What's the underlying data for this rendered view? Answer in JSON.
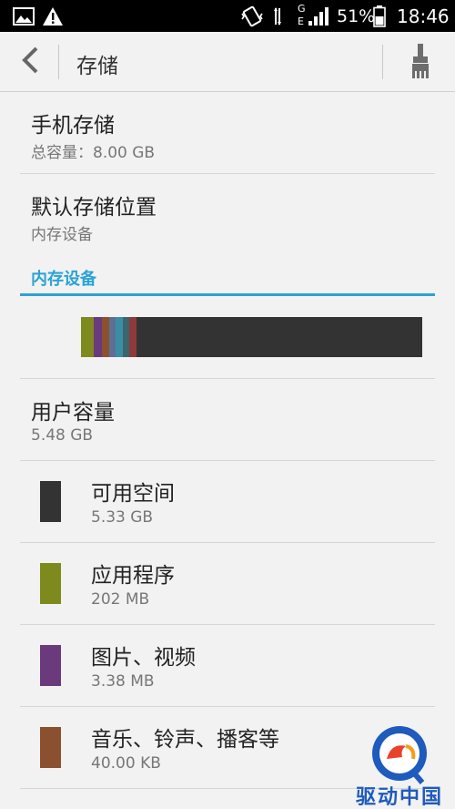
{
  "status_bar": {
    "time": "18:46",
    "battery_percent": "51%",
    "network_letter": "E",
    "sim_letter": "G",
    "icons": [
      "gallery-icon",
      "warning-icon",
      "vibrate-icon",
      "data-arrows-icon",
      "signal-icon",
      "battery-icon"
    ]
  },
  "action_bar": {
    "title": "存储",
    "back_icon": "chevron-left-icon",
    "clean_icon": "brush-icon"
  },
  "phone_storage": {
    "title": "手机存储",
    "subtitle": "总容量：8.00  GB"
  },
  "default_location": {
    "title": "默认存储位置",
    "subtitle": "内存设备"
  },
  "section": {
    "label": "内存设备"
  },
  "usage_bar": {
    "background": "#333333",
    "segments": [
      {
        "name": "应用程序",
        "color": "#7e8a1e",
        "fraction": 0.037
      },
      {
        "name": "图片、视频",
        "color": "#6b3a7d",
        "fraction": 0.024
      },
      {
        "name": "音乐、铃声、播客等",
        "color": "#8a5030",
        "fraction": 0.021
      },
      {
        "name": "other-1",
        "color": "#5e6f93",
        "fraction": 0.019
      },
      {
        "name": "other-2",
        "color": "#3a8ea3",
        "fraction": 0.021
      },
      {
        "name": "other-3",
        "color": "#3a6670",
        "fraction": 0.019
      },
      {
        "name": "other-4",
        "color": "#8f3a3a",
        "fraction": 0.021
      }
    ]
  },
  "user_capacity": {
    "title": "用户容量",
    "value": "5.48 GB"
  },
  "categories": [
    {
      "title": "可用空间",
      "value": "5.33 GB",
      "color": "#333333"
    },
    {
      "title": "应用程序",
      "value": "202 MB",
      "color": "#7e8a1e"
    },
    {
      "title": "图片、视频",
      "value": "3.38 MB",
      "color": "#6b3a7d"
    },
    {
      "title": "音乐、铃声、播客等",
      "value": "40.00 KB",
      "color": "#8a5030"
    }
  ],
  "watermark": {
    "text": "驱动中国"
  }
}
